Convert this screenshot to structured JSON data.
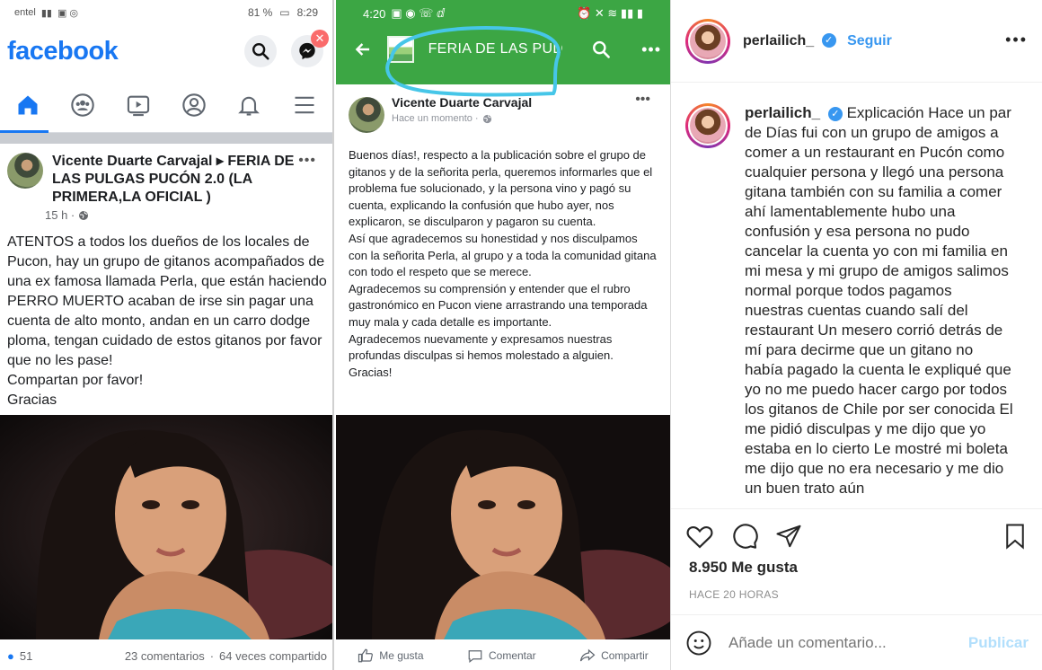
{
  "facebook": {
    "status": {
      "carrier": "entel",
      "battery": "81 %",
      "time": "8:29"
    },
    "logo": "facebook",
    "post": {
      "title": "Vicente Duarte Carvajal ▸ FERIA DE LAS PULGAS PUCÓN 2.0 (LA PRIMERA,LA OFICIAL )",
      "time": "15 h ·",
      "paragraphs": [
        "ATENTOS  a todos los dueños de los locales de Pucon, hay un grupo de gitanos acompañados de una ex famosa llamada Perla, que están haciendo PERRO MUERTO acaban de irse sin pagar una cuenta de alto monto, andan en un carro dodge ploma, tengan cuidado de estos gitanos por favor que no les pase!",
        "Compartan por favor!",
        "Gracias"
      ]
    },
    "reactions": {
      "count": "51",
      "comments": "23 comentarios",
      "shares": "64 veces compartido"
    },
    "icons": {
      "home": "home-icon",
      "groups": "groups-icon",
      "video": "video-icon",
      "profile": "profile-icon",
      "notifications": "bell-icon",
      "menu": "menu-icon",
      "search": "search-icon",
      "messenger": "messenger-icon"
    },
    "accent": "#1877f2"
  },
  "group": {
    "status": {
      "time": "4:20"
    },
    "title": "FERIA DE LAS PULGA...",
    "post": {
      "author": "Vicente Duarte Carvajal",
      "time": "Hace un momento ·",
      "paragraphs": [
        "Buenos días!, respecto a la publicación sobre el grupo de gitanos y de la señorita perla, queremos informarles que el problema fue solucionado, y la persona vino y pagó su cuenta, explicando la confusión que hubo ayer, nos explicaron, se disculparon y pagaron su cuenta.",
        "Así que agradecemos su honestidad y nos disculpamos con la señorita Perla, al grupo y a toda la comunidad gitana con todo el respeto que se merece.",
        "Agradecemos su comprensión y entender que el rubro gastronómico en Pucon viene arrastrando una temporada muy mala y cada detalle es importante.",
        "Agradecemos nuevamente y expresamos nuestras profundas disculpas si hemos molestado a alguien.",
        "Gracias!"
      ]
    },
    "actions": {
      "like": "Me gusta",
      "comment": "Comentar",
      "share": "Compartir"
    },
    "accent": "#3ca644"
  },
  "instagram": {
    "username": "perlailich_",
    "follow": "Seguir",
    "caption_user": "perlailich_",
    "caption": "Explicación Hace un par de Días fui con un grupo de amigos a comer a un restaurant en Pucón como cualquier persona y llegó una persona gitana también con su familia a comer ahí lamentablemente hubo una confusión y esa persona no pudo cancelar la cuenta yo con mi familia en mi mesa y mi grupo de amigos salimos normal porque todos pagamos nuestras cuentas cuando salí del restaurant Un mesero corrió detrás de mí para decirme que un gitano no había pagado la cuenta le expliqué que yo no me puedo hacer cargo por todos los gitanos de Chile por ser conocida El me pidió disculpas y me dijo que yo estaba en lo cierto Le mostré mi boleta me dijo que no era necesario y me dio un buen trato aún",
    "likes": "8.950 Me gusta",
    "time": "HACE 20 HORAS",
    "comment_placeholder": "Añade un comentario...",
    "publish": "Publicar",
    "accent": "#3897f0"
  }
}
